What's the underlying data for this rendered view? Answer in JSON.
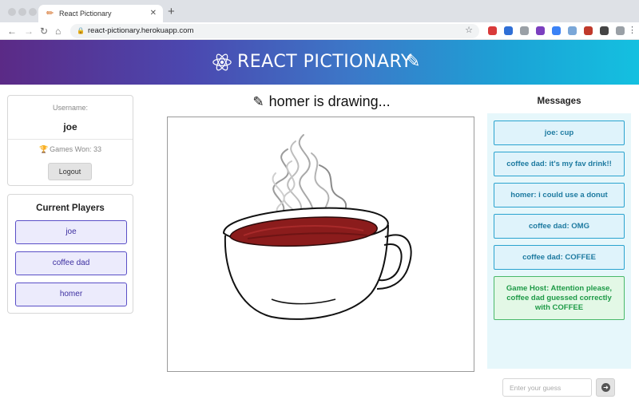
{
  "browser": {
    "tab_title": "React Pictionary",
    "tab_icon": "pencil-icon",
    "close_glyph": "✕",
    "new_tab_glyph": "+",
    "url": "react-pictionary.herokuapp.com",
    "back_glyph": "←",
    "forward_glyph": "→",
    "reload_glyph": "↻",
    "home_glyph": "⌂",
    "star_glyph": "☆",
    "menu_glyph": "⋮",
    "extension_colors": [
      "#d93a3a",
      "#2f6fd6",
      "#9aa0a6",
      "#7b3fbf",
      "#3b82f6",
      "#7aa7d8",
      "#c0392b",
      "#444444",
      "#9aa0a6"
    ]
  },
  "app": {
    "title": "REACT PICTIONARY",
    "header_gradient": [
      "#5b2a86",
      "#14c0e0"
    ]
  },
  "user": {
    "username_label": "Username:",
    "username": "joe",
    "games_won": "Games Won: 33",
    "logout_label": "Logout"
  },
  "players": {
    "title": "Current Players",
    "items": [
      {
        "name": "joe"
      },
      {
        "name": "coffee dad"
      },
      {
        "name": "homer"
      }
    ]
  },
  "canvas": {
    "status": "homer is drawing..."
  },
  "messages": {
    "title": "Messages",
    "items": [
      {
        "text": "joe: cup"
      },
      {
        "text": "coffee dad: it's my fav drink!!"
      },
      {
        "text": "homer: i could use a donut"
      },
      {
        "text": "coffee dad: OMG"
      },
      {
        "text": "coffee dad: COFFEE"
      }
    ],
    "host_message": "Game Host: Attention please, coffee dad guessed correctly with COFFEE"
  },
  "guess": {
    "placeholder": "Enter your guess",
    "value": ""
  }
}
